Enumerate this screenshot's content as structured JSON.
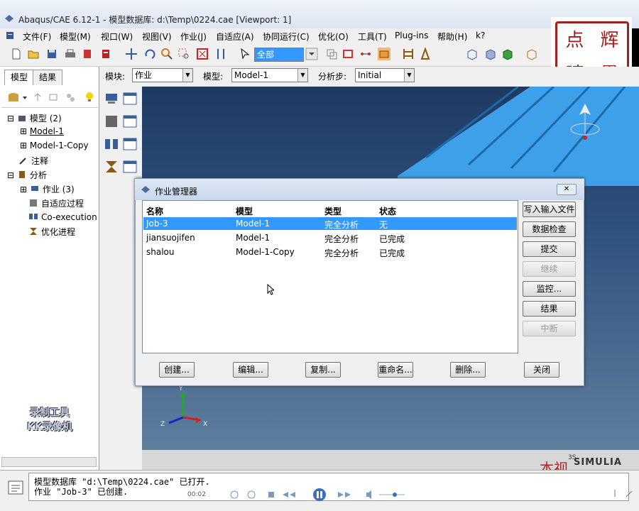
{
  "window": {
    "title": "Abaqus/CAE 6.12-1 - 模型数据库: d:\\Temp\\0224.cae [Viewport: 1]"
  },
  "menu": [
    "文件(F)",
    "模型(M)",
    "视口(W)",
    "视图(V)",
    "作业(J)",
    "自适应(A)",
    "协同运行(C)",
    "优化(O)",
    "工具(T)",
    "Plug-ins",
    "帮助(H)",
    "k?"
  ],
  "toolbar": {
    "selection_filter": "全部"
  },
  "context": {
    "module_label": "模块:",
    "module_value": "作业",
    "model_label": "模型:",
    "model_value": "Model-1",
    "step_label": "分析步:",
    "step_value": "Initial"
  },
  "left_tabs": [
    "模型",
    "结果"
  ],
  "tree": {
    "models": "模型 (2)",
    "model1": "Model-1",
    "model1copy": "Model-1-Copy",
    "annotations": "注释",
    "analysis": "分析",
    "jobs": "作业 (3)",
    "adaptive": "自适应过程",
    "coexec": "Co-execution",
    "optim": "优化进程"
  },
  "seal": [
    "点",
    "辉",
    "晴",
    "墨"
  ],
  "dialog": {
    "title": "作业管理器",
    "columns": [
      "名称",
      "模型",
      "类型",
      "状态"
    ],
    "rows": [
      {
        "name": "Job-3",
        "model": "Model-1",
        "type": "完全分析",
        "status": "无"
      },
      {
        "name": "jiansuojifen",
        "model": "Model-1",
        "type": "完全分析",
        "status": "已完成"
      },
      {
        "name": "shalou",
        "model": "Model-1-Copy",
        "type": "完全分析",
        "status": "已完成"
      }
    ],
    "side_buttons": [
      "写入输入文件",
      "数据检查",
      "提交",
      "继续",
      "监控...",
      "结果",
      "中断"
    ],
    "bottom_buttons": [
      "创建...",
      "编辑...",
      "复制...",
      "重命名...",
      "删除...",
      "关闭"
    ]
  },
  "watermark": [
    "录制工具",
    "KK录像机"
  ],
  "brand": {
    "simulia": "SIMULIA",
    "ds": "3S",
    "benshi": "本视"
  },
  "messages": [
    "模型数据库 \"d:\\Temp\\0224.cae\" 已打开.",
    "作业 \"Job-3\" 已创建."
  ],
  "player": {
    "time": "00:02"
  },
  "colors": {
    "accent": "#3399ff",
    "seal": "#a51d1d",
    "beam": "#3ea0e8"
  }
}
